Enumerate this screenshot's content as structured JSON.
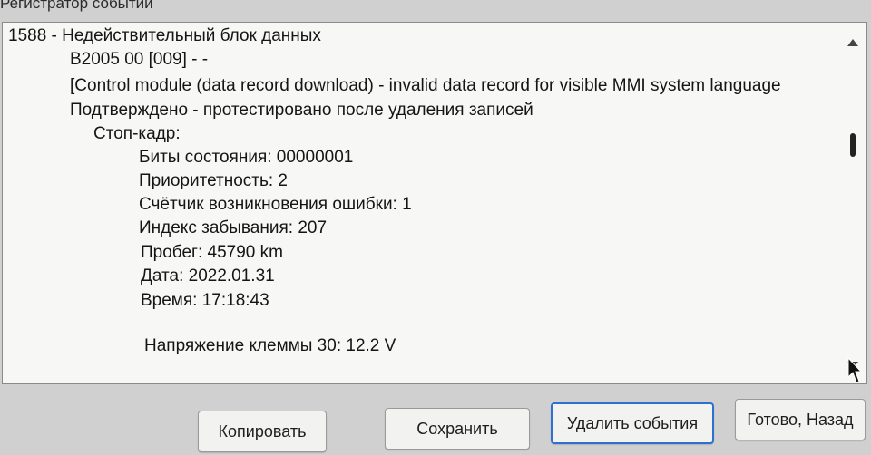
{
  "window": {
    "title": "Регистратор событий"
  },
  "log": {
    "lines": [
      "1588 - Недействительный блок данных",
      "B2005 00 [009] - -",
      "[Control module (data record download) - invalid data record for visible MMI system language",
      "Подтверждено - протестировано после удаления записей",
      "Стоп-кадр:",
      "Биты состояния: 00000001",
      "Приоритетность: 2",
      "Счётчик возникновения ошибки: 1",
      "Индекс забывания: 207",
      "Пробег: 45790 km",
      "Дата: 2022.01.31",
      "Время: 17:18:43",
      "Напряжение клеммы 30: 12.2 V"
    ]
  },
  "buttons": {
    "copy": "Копировать",
    "save": "Сохранить",
    "delete_events": "Удалить события",
    "done_back": "Готово, Назад"
  },
  "icons": {
    "scroll_up": "scroll-up-arrow-icon",
    "scroll_down": "scroll-down-arrow-icon",
    "cursor": "mouse-pointer-icon"
  }
}
